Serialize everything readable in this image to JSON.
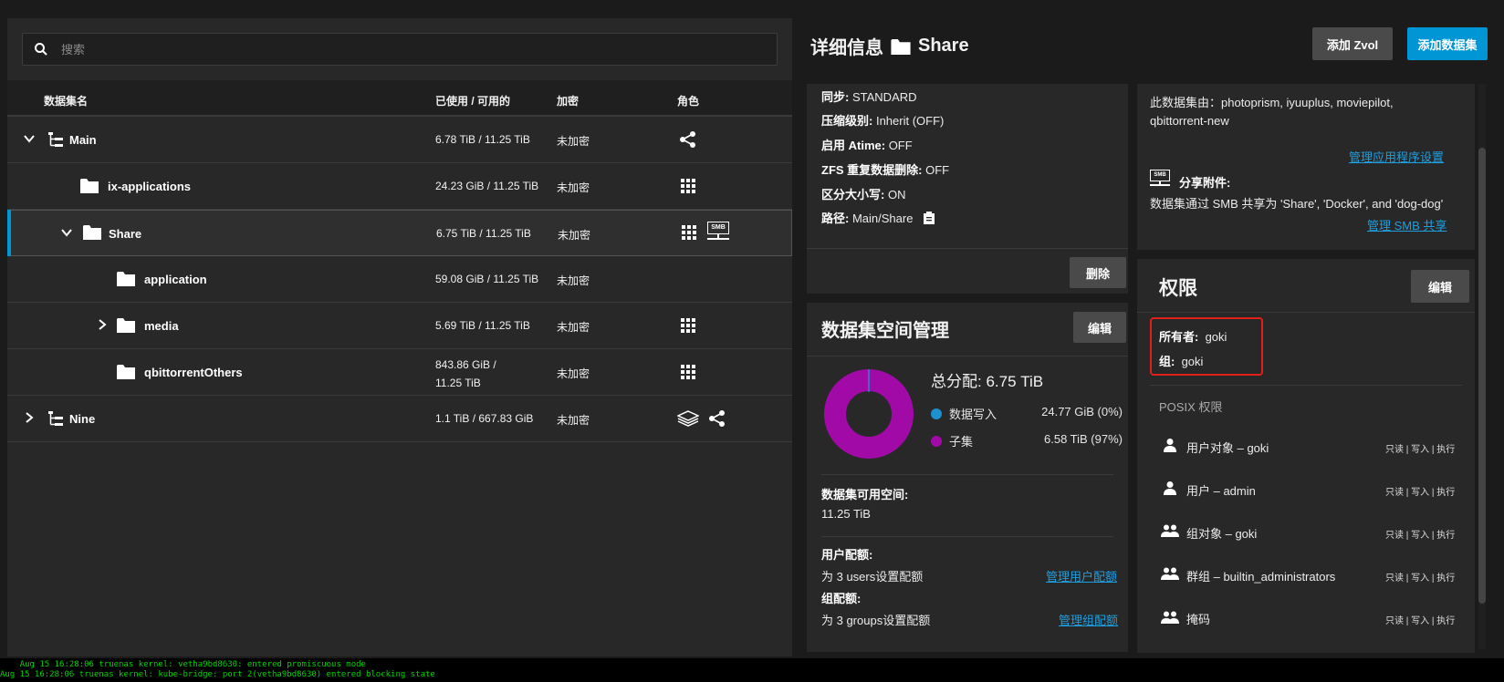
{
  "search": {
    "placeholder": "搜索"
  },
  "table": {
    "headers": {
      "name": "数据集名",
      "used": "已使用 / 可用的",
      "enc": "加密",
      "role": "角色"
    },
    "rows": [
      {
        "name": "Main",
        "used": "6.78 TiB / 11.25 TiB",
        "enc": "未加密"
      },
      {
        "name": "ix-applications",
        "used": "24.23 GiB / 11.25 TiB",
        "enc": "未加密"
      },
      {
        "name": "Share",
        "used": "6.75 TiB / 11.25 TiB",
        "enc": "未加密",
        "role_badge": "SMB"
      },
      {
        "name": "application",
        "used": "59.08 GiB / 11.25 TiB",
        "enc": "未加密"
      },
      {
        "name": "media",
        "used": "5.69 TiB / 11.25 TiB",
        "enc": "未加密"
      },
      {
        "name": "qbittorrentOthers",
        "used_line1": "843.86 GiB /",
        "used_line2": "11.25 TiB",
        "enc": "未加密"
      },
      {
        "name": "Nine",
        "used": "1.1 TiB / 667.83 GiB",
        "enc": "未加密"
      }
    ]
  },
  "header": {
    "title_prefix": "详细信息",
    "title_name": "Share",
    "add_zvol": "添加 Zvol",
    "add_dataset": "添加数据集"
  },
  "details": {
    "sync_label": "同步:",
    "sync_value": "STANDARD",
    "compress_label": "压缩级别:",
    "compress_value": "Inherit (OFF)",
    "atime_label": "启用 Atime:",
    "atime_value": "OFF",
    "dedup_label": "ZFS 重复数据删除:",
    "dedup_value": "OFF",
    "case_label": "区分大小写:",
    "case_value": "ON",
    "path_label": "路径:",
    "path_value": "Main/Share",
    "delete": "删除"
  },
  "space": {
    "title": "数据集空间管理",
    "edit": "编辑",
    "total_label": "总分配:",
    "total_value": "6.75 TiB",
    "legend": [
      {
        "name": "数据写入",
        "value": "24.77 GiB (0%)",
        "color": "#1e8fcf"
      },
      {
        "name": "子集",
        "value": "6.58 TiB (97%)",
        "color": "#a20aa8"
      }
    ],
    "available_label": "数据集可用空间:",
    "available_value": "11.25 TiB",
    "user_quota_label": "用户配额:",
    "user_quota_value": "为 3 users设置配额",
    "user_quota_link": "管理用户配额",
    "group_quota_label": "组配额:",
    "group_quota_value": "为 3 groups设置配额",
    "group_quota_link": "管理组配额"
  },
  "apps": {
    "used_by": "此数据集由：photoprism, iyuuplus, moviepilot,",
    "used_by_2": "qbittorrent-new",
    "manage_apps": "管理应用程序设置",
    "smb_title": "分享附件:",
    "smb_text": "数据集通过 SMB 共享为 'Share', 'Docker', and 'dog-dog'",
    "manage_smb": "管理 SMB 共享"
  },
  "permissions": {
    "title": "权限",
    "edit": "编辑",
    "owner_label": "所有者:",
    "owner_value": "goki",
    "group_label": "组:",
    "group_value": "goki",
    "posix": "POSIX 权限",
    "entries": [
      {
        "name": "用户对象 – goki",
        "perm": "只读 | 写入 | 执行",
        "icon": "user"
      },
      {
        "name": "用户 – admin",
        "perm": "只读 | 写入 | 执行",
        "icon": "user"
      },
      {
        "name": "组对象 – goki",
        "perm": "只读 | 写入 | 执行",
        "icon": "group"
      },
      {
        "name": "群组 – builtin_administrators",
        "perm": "只读 | 写入 | 执行",
        "icon": "group"
      },
      {
        "name": "掩码",
        "perm": "只读 | 写入 | 执行",
        "icon": "group"
      }
    ]
  },
  "console": {
    "line1": "    Aug 15 16:28:06 truenas kernel: vetha9bd8630: entered promiscuous mode",
    "line2": "Aug 15 16:28:06 truenas kernel: kube-bridge: port 2(vetha9bd8630) entered blocking state"
  }
}
